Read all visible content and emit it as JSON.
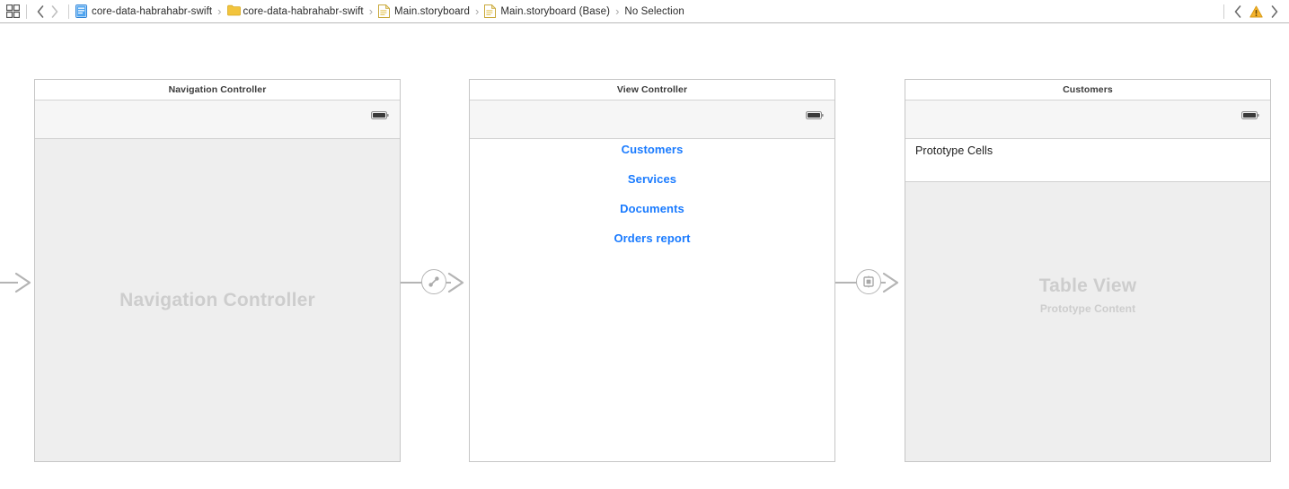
{
  "toolbar": {
    "panel_toggle_name": "grid-icon",
    "back_label": "‹",
    "forward_label": "›",
    "separator": "›",
    "breadcrumbs": [
      {
        "label": "core-data-habrahabr-swift",
        "icon": "project-icon"
      },
      {
        "label": "core-data-habrahabr-swift",
        "icon": "folder-icon"
      },
      {
        "label": "Main.storyboard",
        "icon": "storyboard-icon"
      },
      {
        "label": "Main.storyboard (Base)",
        "icon": "storyboard-icon"
      },
      {
        "label": "No Selection",
        "icon": "none"
      }
    ],
    "issue_prev_label": "‹",
    "issue_next_label": "›",
    "issue_icon": "warning-triangle-icon"
  },
  "canvas": {
    "entry_arrow_name": "initial-view-controller-arrow",
    "segues": [
      {
        "name": "relationship-segue",
        "icon": "relationship-segue-icon"
      },
      {
        "name": "show-segue",
        "icon": "show-segue-icon"
      }
    ],
    "scenes": [
      {
        "id": "navigation-controller",
        "title": "Navigation Controller",
        "placeholder_title": "Navigation Controller",
        "placeholder_sub": "",
        "body_style": "gray",
        "battery_icon": "battery-icon"
      },
      {
        "id": "view-controller",
        "title": "View Controller",
        "placeholder_title": "",
        "placeholder_sub": "",
        "body_style": "white",
        "battery_icon": "battery-icon",
        "buttons": [
          "Customers",
          "Services",
          "Documents",
          "Orders report"
        ]
      },
      {
        "id": "customers-table-view-controller",
        "title": "Customers",
        "prototype_cell_label": "Prototype Cells",
        "placeholder_title": "Table View",
        "placeholder_sub": "Prototype Content",
        "body_style": "gray",
        "battery_icon": "battery-icon"
      }
    ]
  },
  "colors": {
    "link_blue": "#1a7bff",
    "placeholder_gray": "#cdcdcd",
    "scene_border": "#c6c6c6",
    "warning_yellow": "#f5b32c",
    "folder_yellow": "#f0c040",
    "project_blue": "#3d9bf5"
  }
}
